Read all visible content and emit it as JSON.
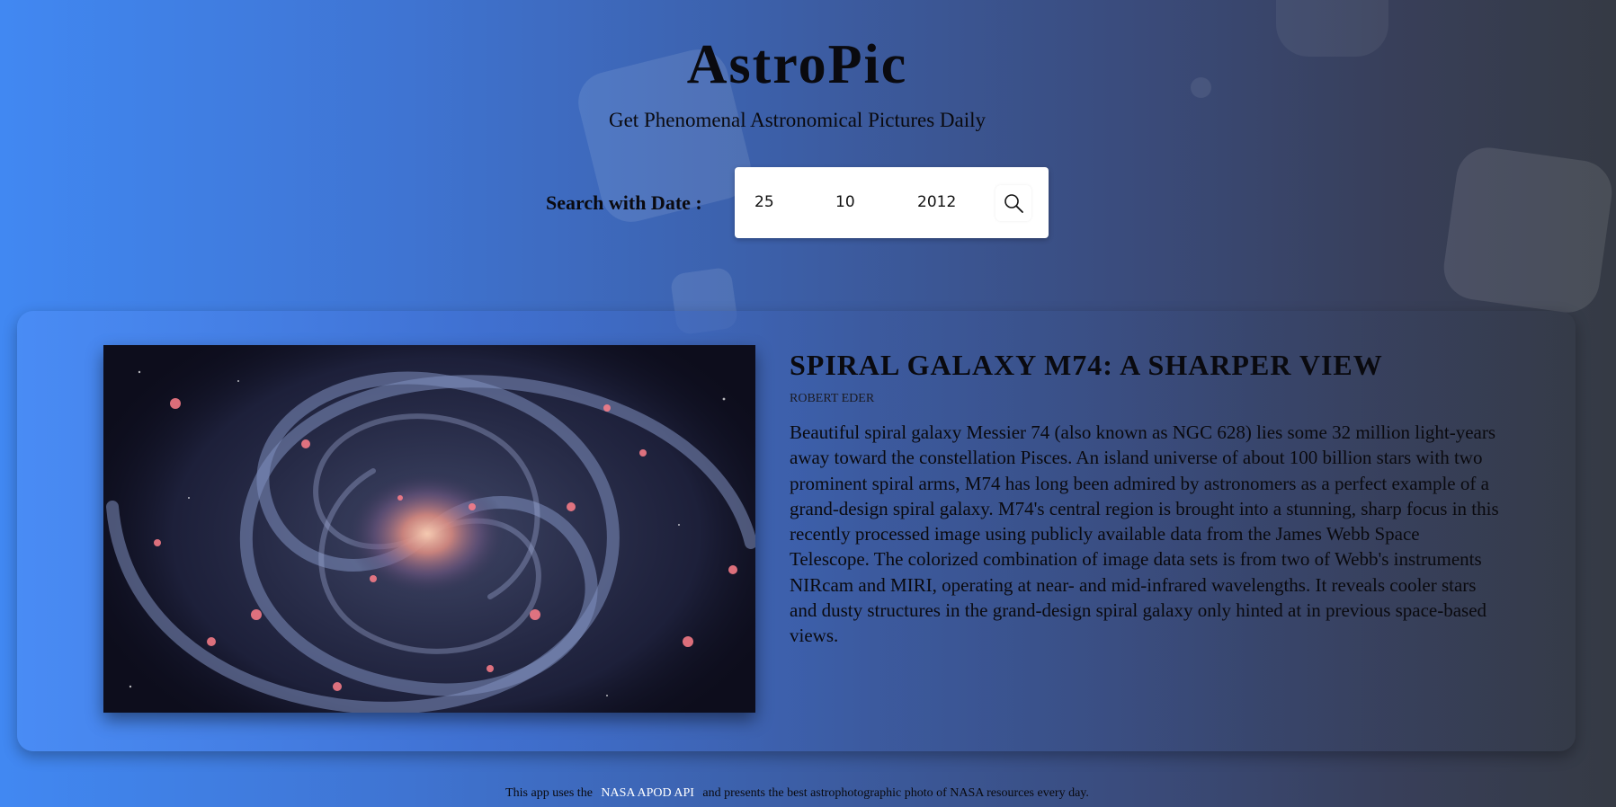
{
  "header": {
    "title": "AstroPic",
    "subtitle": "Get Phenomenal Astronomical Pictures Daily"
  },
  "search": {
    "label": "Search with Date :",
    "day": "25",
    "month": "10",
    "year": "2012",
    "button_icon": "search-icon"
  },
  "apod": {
    "title": "SPIRAL GALAXY M74: A SHARPER VIEW",
    "author": "ROBERT EDER",
    "image_alt": "Spiral galaxy M74 photograph",
    "explanation": "Beautiful spiral galaxy Messier 74 (also known as NGC 628) lies some 32 million light-years away toward the constellation Pisces. An island universe of about 100 billion stars with two prominent spiral arms, M74 has long been admired by astronomers as a perfect example of a grand-design spiral galaxy. M74's central region is brought into a stunning, sharp focus in this recently processed image using publicly available data from the James Webb Space Telescope. The colorized combination of image data sets is from two of Webb's instruments NIRcam and MIRI, operating at near- and mid-infrared wavelengths. It reveals cooler stars and dusty structures in the grand-design spiral galaxy only hinted at in previous space-based views."
  },
  "footer": {
    "prefix": "This app uses the",
    "link": "NASA APOD API",
    "suffix": "and presents the best astrophotographic photo of NASA resources every day."
  },
  "colors": {
    "gradient_start": "#4188f2",
    "gradient_end": "#353a44",
    "link": "#ffffff"
  }
}
